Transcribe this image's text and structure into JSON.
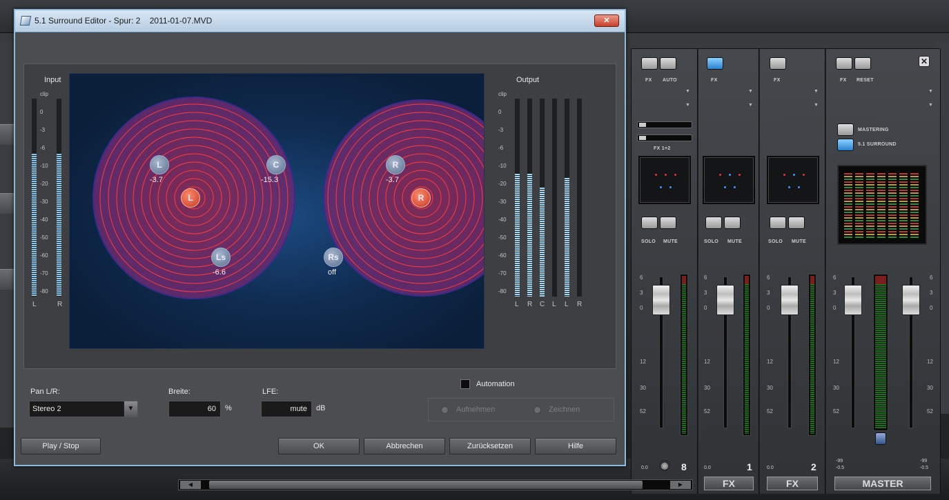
{
  "dialog": {
    "title": "5.1 Surround Editor - Spur: 2    2011-01-07.MVD",
    "close_label": "✕",
    "input_label": "Input",
    "output_label": "Output",
    "input_scale": [
      "clip",
      "0",
      "-3",
      "-6",
      "-10",
      "-20",
      "-30",
      "-40",
      "-50",
      "-60",
      "-70",
      "-80"
    ],
    "input_channels": [
      "L",
      "R"
    ],
    "input_levels": [
      0.72,
      0.72
    ],
    "output_scale": [
      "clip",
      "0",
      "-3",
      "-6",
      "-10",
      "-20",
      "-30",
      "-40",
      "-50",
      "-60",
      "-70",
      "-80"
    ],
    "output_channels": [
      "L",
      "R",
      "C",
      "L",
      "L",
      "R"
    ],
    "output_levels": [
      0.62,
      0.62,
      0.55,
      0,
      0.6,
      0
    ],
    "speakers": [
      {
        "id": "L",
        "label": "L",
        "value": "-3.7"
      },
      {
        "id": "C",
        "label": "C",
        "value": "-15.3"
      },
      {
        "id": "R",
        "label": "R",
        "value": "-3.7"
      },
      {
        "id": "Ls",
        "label": "Ls",
        "value": "-6.6"
      },
      {
        "id": "Rs",
        "label": "Rs",
        "value": "off"
      },
      {
        "id": "L_source",
        "label": "L"
      },
      {
        "id": "R_source",
        "label": "R"
      }
    ],
    "pan_label": "Pan L/R:",
    "pan_value": "Stereo 2",
    "width_label": "Breite:",
    "width_value": "60",
    "width_unit": "%",
    "lfe_label": "LFE:",
    "lfe_value": "mute",
    "lfe_unit": "dB",
    "automation_label": "Automation",
    "record_label": "Aufnehmen",
    "draw_label": "Zeichnen",
    "buttons": {
      "play_stop": "Play / Stop",
      "ok": "OK",
      "cancel": "Abbrechen",
      "reset": "Zurücksetzen",
      "help": "Hilfe"
    }
  },
  "mixer": {
    "strips": [
      {
        "top_labels": [
          "FX",
          "AUTO"
        ],
        "fx_label": "FX 1+2",
        "solo": "SOLO",
        "mute": "MUTE",
        "value": "0.0",
        "number": "8",
        "bottom_label": ""
      },
      {
        "top_labels": [
          "FX"
        ],
        "solo": "SOLO",
        "mute": "MUTE",
        "value": "0.0",
        "number": "1",
        "bottom_label": "FX"
      },
      {
        "top_labels": [
          "FX"
        ],
        "solo": "SOLO",
        "mute": "MUTE",
        "value": "0.0",
        "number": "2",
        "bottom_label": "FX"
      },
      {
        "top_labels": [
          "FX",
          "RESET"
        ],
        "mastering": "MASTERING",
        "surround": "5.1 SURROUND",
        "values": [
          "-99",
          "-99"
        ],
        "subvalues": [
          "-0.5",
          "-0.5"
        ],
        "bottom_label": "MASTER"
      }
    ],
    "fader_scale": [
      "6",
      "3",
      "0",
      "3",
      "12",
      "30",
      "52"
    ],
    "close_label": "✕"
  }
}
